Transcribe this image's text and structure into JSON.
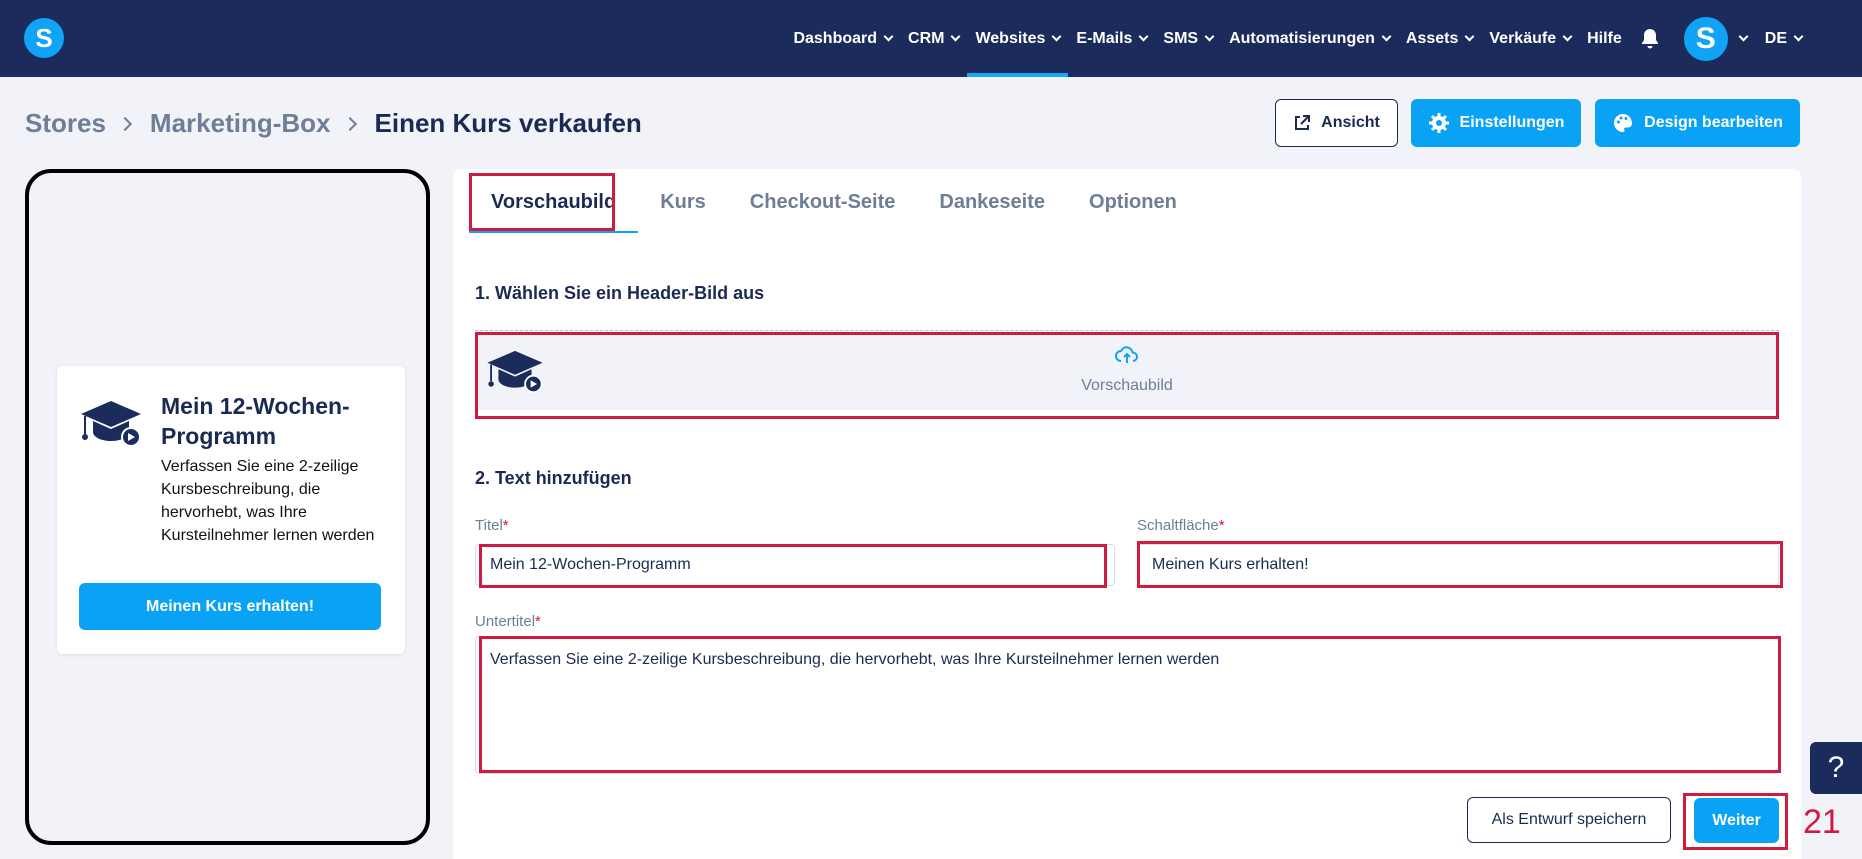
{
  "logo": {
    "letter": "S"
  },
  "nav": {
    "items": [
      {
        "label": "Dashboard",
        "dropdown": true
      },
      {
        "label": "CRM",
        "dropdown": true
      },
      {
        "label": "Websites",
        "dropdown": true,
        "active": true
      },
      {
        "label": "E-Mails",
        "dropdown": true
      },
      {
        "label": "SMS",
        "dropdown": true
      },
      {
        "label": "Automatisierungen",
        "dropdown": true
      },
      {
        "label": "Assets",
        "dropdown": true
      },
      {
        "label": "Verkäufe",
        "dropdown": true
      },
      {
        "label": "Hilfe",
        "dropdown": false
      }
    ],
    "notification_icon": "bell-icon",
    "avatar_letter": "S",
    "language": "DE"
  },
  "breadcrumb": {
    "items": [
      "Stores",
      "Marketing-Box",
      "Einen Kurs verkaufen"
    ]
  },
  "actions": {
    "view_label": "Ansicht",
    "settings_label": "Einstellungen",
    "design_label": "Design bearbeiten"
  },
  "preview": {
    "title": "Mein 12-Wochen-Programm",
    "subtitle": "Verfassen Sie eine 2-zeilige Kursbeschreibung, die hervorhebt, was Ihre Kursteilnehmer lernen werden",
    "button_label": "Meinen Kurs erhalten!"
  },
  "tabs": [
    {
      "label": "Vorschaubild",
      "active": true
    },
    {
      "label": "Kurs"
    },
    {
      "label": "Checkout-Seite"
    },
    {
      "label": "Dankeseite"
    },
    {
      "label": "Optionen"
    }
  ],
  "section1": {
    "title": "1. Wählen Sie ein Header-Bild aus",
    "upload_label": "Vorschaubild"
  },
  "section2": {
    "title": "2. Text hinzufügen",
    "title_label": "Titel",
    "title_value": "Mein 12-Wochen-Programm",
    "button_label": "Schaltfläche",
    "button_value": "Meinen Kurs erhalten!",
    "subtitle_label": "Untertitel",
    "subtitle_value": "Verfassen Sie eine 2-zeilige Kursbeschreibung, die hervorhebt, was Ihre Kursteilnehmer lernen werden",
    "required_mark": "*"
  },
  "footer": {
    "draft_label": "Als Entwurf speichern",
    "next_label": "Weiter",
    "step_number": "21"
  },
  "help": {
    "label": "?"
  },
  "colors": {
    "nav_bg": "#1b2b5c",
    "accent": "#0aa2f5",
    "highlight": "#cf1b3f",
    "text_dark": "#1b2a52",
    "text_muted": "#6f7d96"
  }
}
